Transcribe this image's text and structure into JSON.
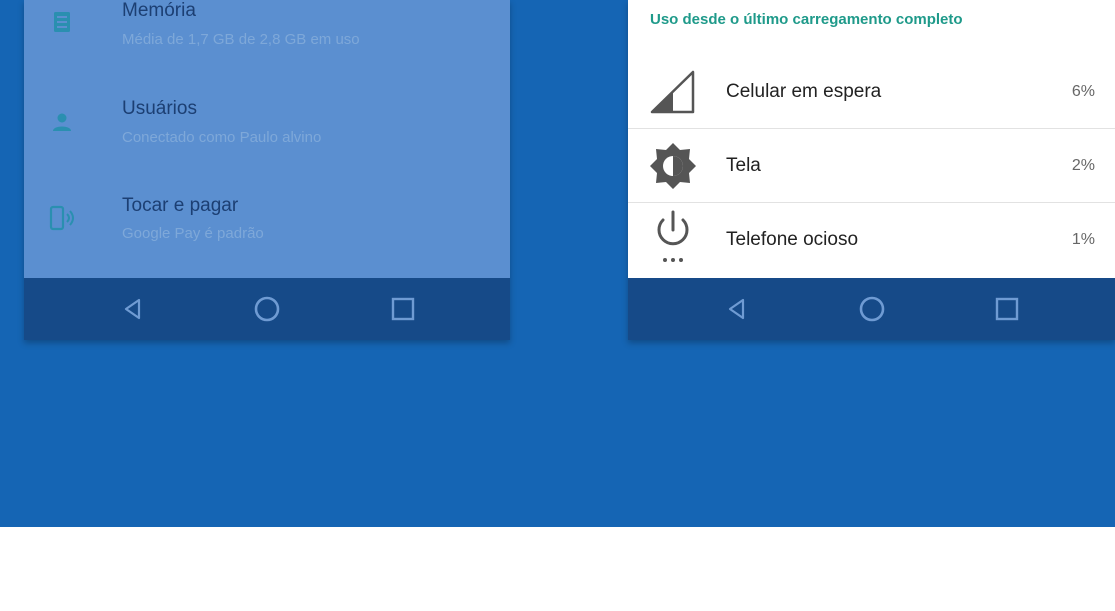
{
  "colors": {
    "background_blue": "#1565b4",
    "left_screen": "#5b8fd0",
    "navbar": "#164a88",
    "header_teal": "#1f9a8a"
  },
  "left_phone": {
    "settings": [
      {
        "icon": "memory-icon",
        "title": "Memória",
        "subtitle": "Média de 1,7 GB de 2,8 GB em uso"
      },
      {
        "icon": "user-icon",
        "title": "Usuários",
        "subtitle": "Conectado como Paulo alvino"
      },
      {
        "icon": "tap-pay-icon",
        "title": "Tocar e pagar",
        "subtitle": "Google Pay é padrão"
      }
    ],
    "nav": [
      "back-icon",
      "home-icon",
      "recents-icon"
    ]
  },
  "right_phone": {
    "section_header": "Uso desde o último carregamento completo",
    "battery_items": [
      {
        "icon": "cell-signal-icon",
        "label": "Celular em espera",
        "percent": "6%"
      },
      {
        "icon": "brightness-icon",
        "label": "Tela",
        "percent": "2%"
      },
      {
        "icon": "power-icon",
        "label": "Telefone ocioso",
        "percent": "1%"
      }
    ],
    "nav": [
      "back-icon",
      "home-icon",
      "recents-icon"
    ]
  }
}
